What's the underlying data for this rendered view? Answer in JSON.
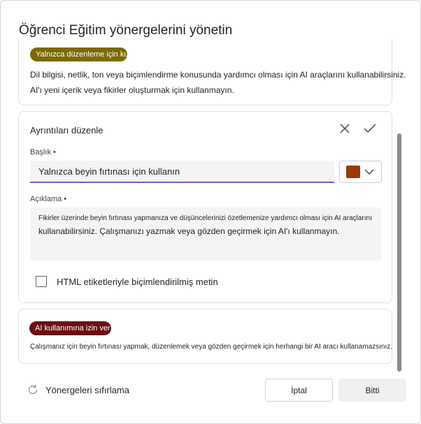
{
  "dialog": {
    "title": "Öğrenci Eğitim yönergelerini yönetin"
  },
  "guideline_top": {
    "badge": "Yalnızca düzenleme için ku",
    "badge_color": "#7a6a00",
    "description_line1": "Dil bilgisi, netlik, ton veya biçimlendirme konusunda yardımcı olması için AI araçlarını kullanabilirsiniz.",
    "description_line2": "AI'ı yeni içerik veya fikirler oluşturmak için kullanmayın."
  },
  "edit_panel": {
    "header": "Ayrıntıları düzenle",
    "close_icon": "close-icon",
    "confirm_icon": "checkmark-icon",
    "title_label": "Başlık •",
    "title_value": "Yalnızca beyin fırtınası için kullanın",
    "color_value": "#9a3a05",
    "description_label": "Açıklama •",
    "description_line1": "Fikirler üzerinde beyin fırtınası yapmanıza ve düşüncelerinizi özetlemenize yardımcı olması için AI araçlarını",
    "description_line2": "kullanabilirsiniz. Çalışmanızı yazmak veya gözden geçirmek için AI'ı kullanmayın.",
    "html_checkbox_label": "HTML etiketleriyle biçimlendirilmiş metin",
    "html_checkbox_checked": false
  },
  "guideline_bottom": {
    "badge": "AI kullanımına izin ver",
    "badge_color": "#6b0d14",
    "description": "Çalışmanız için beyin fırtınası yapmak, düzenlemek veya gözden geçirmek için herhangi bir AI aracı kullanamazsınız."
  },
  "footer": {
    "reset_label": "Yönergeleri sıfırlama",
    "cancel_label": "İptal",
    "done_label": "Bitti"
  }
}
